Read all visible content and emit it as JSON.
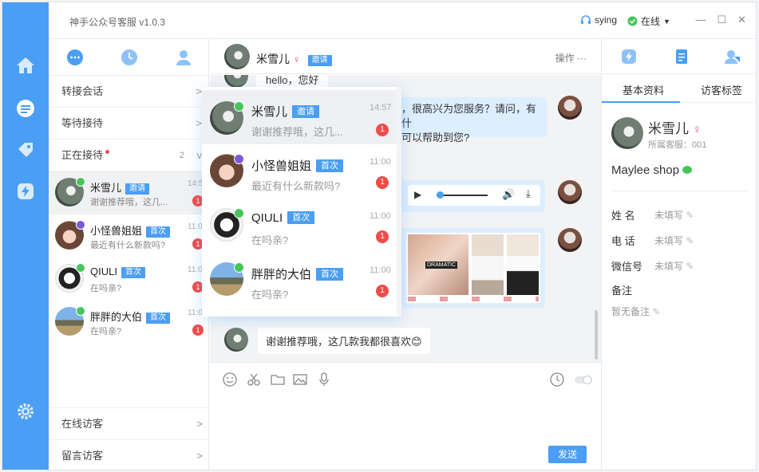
{
  "titlebar": {
    "app_title": "神手公众号客服 v1.0.3",
    "user_name": "sying",
    "status": "在线"
  },
  "nav": {
    "items": [
      "home-icon",
      "chat-icon",
      "tag-icon",
      "flash-icon",
      "settings-icon"
    ]
  },
  "left_panel": {
    "tab_icons": [
      "message-icon",
      "clock-icon",
      "user-icon"
    ],
    "sections": [
      {
        "label": "转接会话",
        "arrow": ">"
      },
      {
        "label": "等待接待",
        "arrow": ">"
      },
      {
        "label": "正在接待",
        "count": "2",
        "arrow": "v"
      }
    ],
    "conversations": [
      {
        "name": "米雪儿",
        "tag": "邀请",
        "message": "谢谢推荐哦，这几...",
        "time": "14:57",
        "unread": "1"
      },
      {
        "name": "小怪兽姐姐",
        "tag": "首次",
        "message": "最近有什么新款吗?",
        "time": "11:00",
        "unread": "1"
      },
      {
        "name": "QIULI",
        "tag": "首次",
        "message": "在吗亲?",
        "time": "11:00",
        "unread": "1"
      },
      {
        "name": "胖胖的大伯",
        "tag": "首次",
        "message": "在吗亲?",
        "time": "11:00",
        "unread": "1"
      }
    ],
    "bottom": [
      {
        "label": "在线访客",
        "arrow": ">"
      },
      {
        "label": "留言访客",
        "arrow": ">"
      }
    ]
  },
  "chat": {
    "header": {
      "name": "米雪儿",
      "tag": "邀请",
      "ops": "操作 ···"
    },
    "messages": {
      "first": "hello，您好",
      "reply_line1": "，很高兴为您服务？请问，有什",
      "reply_line2": "可以帮助到您?",
      "last": "谢谢推荐哦，这几款我都很喜欢😊"
    },
    "product_labels": [
      "DRAMATIC"
    ],
    "send": "发送"
  },
  "popup": {
    "items": [
      {
        "name": "米雪儿",
        "tag": "邀请",
        "message": "谢谢推荐哦，这几...",
        "time": "14:57",
        "unread": "1"
      },
      {
        "name": "小怪兽姐姐",
        "tag": "首次",
        "message": "最近有什么新款吗?",
        "time": "11:00",
        "unread": "1"
      },
      {
        "name": "QIULI",
        "tag": "首次",
        "message": "在吗亲?",
        "time": "11:00",
        "unread": "1"
      },
      {
        "name": "胖胖的大伯",
        "tag": "首次",
        "message": "在吗亲?",
        "time": "11:00",
        "unread": "1"
      }
    ]
  },
  "right_panel": {
    "tabs": [
      "基本资料",
      "访客标签"
    ],
    "name": "米雪儿",
    "agent": "所属客服：001",
    "shop": "Maylee shop",
    "fields": [
      {
        "label": "姓  名",
        "value": "未填写"
      },
      {
        "label": "电  话",
        "value": "未填写"
      },
      {
        "label": "微信号",
        "value": "未填写"
      }
    ],
    "note_label": "备注",
    "note_value": "暂无备注"
  },
  "colors": {
    "accent": "#4a9ef3",
    "unread": "#f04b4b",
    "wechat": "#46c55c"
  }
}
